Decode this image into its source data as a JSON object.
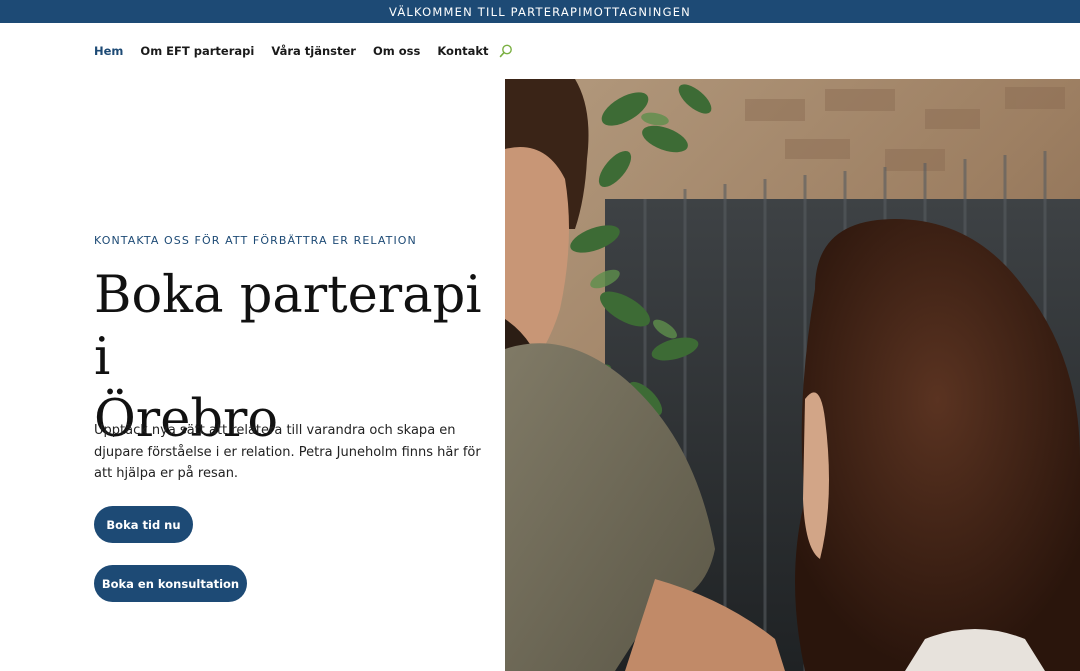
{
  "topbar": {
    "text": "VÄLKOMMEN TILL PARTERAPIMOTTAGNINGEN"
  },
  "nav": {
    "items": [
      "Hem",
      "Om EFT parterapi",
      "Våra tjänster",
      "Om oss",
      "Kontakt"
    ],
    "active_index": 0,
    "search_icon": "search-icon"
  },
  "hero": {
    "eyebrow": "KONTAKTA OSS FÖR ATT FÖRBÄTTRA ER RELATION",
    "headline_line1": "Boka parterapi i",
    "headline_line2": "Örebro",
    "lead": "Upptäck nya sätt att relatera till varandra och skapa en djupare förståelse i er relation. Petra Juneholm finns här för att hjälpa er på resan.",
    "button_primary": "Boka tid nu",
    "button_secondary": "Boka en konsultation"
  },
  "colors": {
    "brand": "#1d4a75",
    "search_icon": "#7bb043"
  }
}
